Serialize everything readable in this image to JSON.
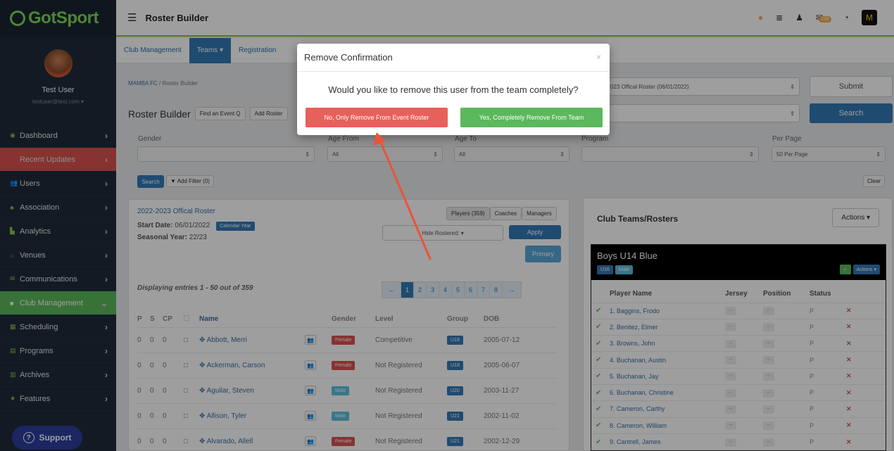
{
  "app": {
    "logo": "GotSport",
    "page_title": "Roster Builder"
  },
  "topbar": {
    "mail_badge": "236",
    "icons": [
      "help-icon",
      "list-icon",
      "user-icon",
      "mail-icon",
      "chat-icon",
      "team-logo-icon"
    ],
    "team_logo": "M"
  },
  "sidebar": {
    "user_name": "Test User",
    "user_email": "testuser@test.com ▾",
    "items": [
      {
        "label": "Dashboard",
        "icon": "dashboard-icon"
      },
      {
        "label": "Recent Updates",
        "icon": "updates-icon"
      },
      {
        "label": "Users",
        "icon": "users-icon"
      },
      {
        "label": "Association",
        "icon": "association-icon"
      },
      {
        "label": "Analytics",
        "icon": "analytics-icon"
      },
      {
        "label": "Venues",
        "icon": "venues-icon"
      },
      {
        "label": "Communications",
        "icon": "communications-icon"
      },
      {
        "label": "Club Management",
        "icon": "club-icon"
      },
      {
        "label": "Scheduling",
        "icon": "scheduling-icon"
      },
      {
        "label": "Programs",
        "icon": "programs-icon"
      },
      {
        "label": "Archives",
        "icon": "archives-icon"
      },
      {
        "label": "Features",
        "icon": "features-icon"
      }
    ],
    "support": "Support"
  },
  "subnav": {
    "club": "Club Management",
    "teams": "Teams ▾",
    "registration": "Registration"
  },
  "breadcrumb": {
    "club": "MAMBA FC",
    "sep": "/",
    "current": "Roster Builder"
  },
  "builder": {
    "title": "Roster Builder",
    "find_event": "Find an Event Q",
    "add_roster": "Add Roster"
  },
  "top_right": {
    "roster_select": "023 Offical Roster (06/01/2022)",
    "submit": "Submit",
    "search": "Search"
  },
  "filters": {
    "gender_label": "Gender",
    "age_from_label": "Age From",
    "age_to_label": "Age To",
    "program_label": "Program",
    "per_page_label": "Per Page",
    "age_from": "All",
    "age_to": "All",
    "per_page": "50 Per Page",
    "search_btn": "Search",
    "add_filter": "▼ Add Filter (0)",
    "clear": "Clear"
  },
  "roster": {
    "title": "2022-2023 Offical Roster",
    "start_label": "Start Date:",
    "start_date": "06/01/2022",
    "calendar_tag": "Calendar Year",
    "season_label": "Seasonal Year:",
    "season": "22/23",
    "tabs": [
      "Players (359)",
      "Coaches",
      "Managers"
    ],
    "hide_rostered": "Hide Rostered: ▾",
    "apply": "Apply",
    "primary": "Primary",
    "entries": "Displaying entries 1 - 50 out of 359",
    "pagination": [
      "←",
      "1",
      "2",
      "3",
      "4",
      "5",
      "6",
      "7",
      "8",
      "→"
    ],
    "headers": [
      "P",
      "S",
      "CP",
      "",
      "Name",
      "",
      "Gender",
      "Level",
      "Group",
      "DOB"
    ],
    "rows": [
      {
        "p": "0",
        "s": "0",
        "cp": "0",
        "name": "Abbott, Merri",
        "gender": "Female",
        "level": "Competitive",
        "group": "U18",
        "dob": "2005-07-12"
      },
      {
        "p": "0",
        "s": "0",
        "cp": "0",
        "name": "Ackerman, Carson",
        "gender": "Female",
        "level": "Not Registered",
        "group": "U18",
        "dob": "2005-06-07"
      },
      {
        "p": "0",
        "s": "0",
        "cp": "0",
        "name": "Aguilar, Steven",
        "gender": "Male",
        "level": "Not Registered",
        "group": "U20",
        "dob": "2003-11-27"
      },
      {
        "p": "0",
        "s": "0",
        "cp": "0",
        "name": "Allison, Tyler",
        "gender": "Male",
        "level": "Not Registered",
        "group": "U21",
        "dob": "2002-11-02"
      },
      {
        "p": "0",
        "s": "0",
        "cp": "0",
        "name": "Alvarado, Allell",
        "gender": "Female",
        "level": "Not Registered",
        "group": "U21",
        "dob": "2002-12-29"
      }
    ]
  },
  "club_teams": {
    "title": "Club Teams/Rosters",
    "actions": "Actions ▾",
    "team_name": "Boys U14 Blue",
    "team_tags": [
      "U16",
      "Male"
    ],
    "team_actions": "Actions ▾",
    "headers": [
      "Player Name",
      "Jersey",
      "Position",
      "Status"
    ],
    "players": [
      {
        "name": "1. Baggins, Frodo",
        "jersey": "--",
        "position": "--",
        "status": "P"
      },
      {
        "name": "2. Benitez, Elmer",
        "jersey": "--",
        "position": "--",
        "status": "P"
      },
      {
        "name": "3. Browns, John",
        "jersey": "--",
        "position": "--",
        "status": "P"
      },
      {
        "name": "4. Buchanan, Austin",
        "jersey": "--",
        "position": "--",
        "status": "P"
      },
      {
        "name": "5. Buchanan, Jay",
        "jersey": "--",
        "position": "--",
        "status": "P"
      },
      {
        "name": "6. Buchanan, Christine",
        "jersey": "--",
        "position": "--",
        "status": "P"
      },
      {
        "name": "7. Cameron, Carthy",
        "jersey": "--",
        "position": "--",
        "status": "P"
      },
      {
        "name": "8. Cameron, William",
        "jersey": "--",
        "position": "--",
        "status": "P"
      },
      {
        "name": "9. Cantrell, James",
        "jersey": "--",
        "position": "--",
        "status": "P"
      }
    ]
  },
  "modal": {
    "title": "Remove Confirmation",
    "close": "×",
    "question": "Would you like to remove this user from the team completely?",
    "no_btn": "No, Only Remove From Event Roster",
    "yes_btn": "Yes, Completely Remove From Team"
  },
  "colors": {
    "brand_green": "#7ed957",
    "sidebar": "#1f2b3a",
    "primary": "#337ab7",
    "danger": "#e8605c",
    "success": "#5cb85c",
    "annotation_arrow": "#e8543a"
  }
}
